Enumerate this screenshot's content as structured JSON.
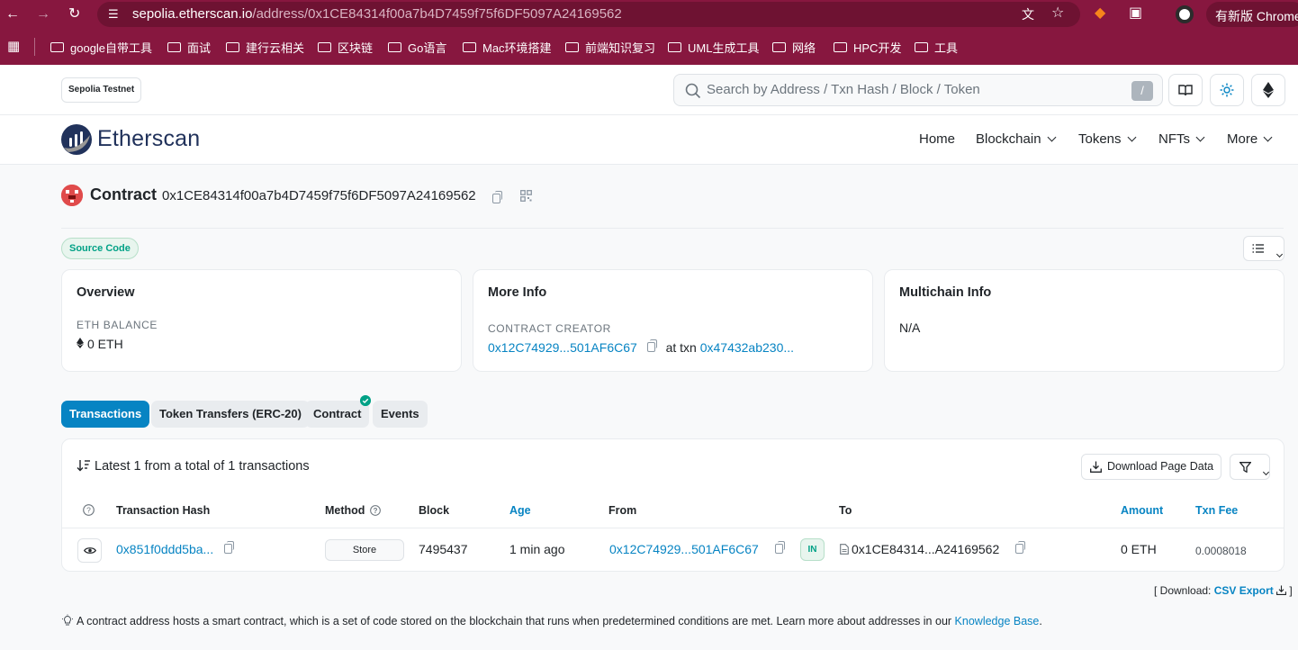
{
  "browser": {
    "url_host": "sepolia.etherscan.io",
    "url_path": "/address/0x1CE84314f00a7b4D7459f75f6DF5097A24169562",
    "update_label": "有新版 Chrome",
    "bookmarks": [
      "google自带工具",
      "面试",
      "建行云相关",
      "区块链",
      "Go语言",
      "Mac环境搭建",
      "前端知识复习",
      "UML生成工具",
      "网络",
      "HPC开发",
      "工具"
    ]
  },
  "header": {
    "network_label": "Sepolia Testnet",
    "search_placeholder": "Search by Address / Txn Hash / Block / Token",
    "search_shortcut": "/",
    "logo_text": "Etherscan",
    "nav": [
      "Home",
      "Blockchain",
      "Tokens",
      "NFTs",
      "More"
    ]
  },
  "contract": {
    "title": "Contract",
    "address": "0x1CE84314f00a7b4D7459f75f6DF5097A24169562",
    "source_badge": "Source Code"
  },
  "overview": {
    "title": "Overview",
    "balance_label": "ETH BALANCE",
    "balance_value": "0 ETH"
  },
  "more_info": {
    "title": "More Info",
    "creator_label": "CONTRACT CREATOR",
    "creator_address": "0x12C74929...501AF6C67",
    "at_txn_label": "at txn",
    "txn_hash": "0x47432ab230..."
  },
  "multichain": {
    "title": "Multichain Info",
    "value": "N/A"
  },
  "tabs": [
    "Transactions",
    "Token Transfers (ERC-20)",
    "Contract",
    "Events"
  ],
  "transactions": {
    "summary": "Latest 1 from a total of 1 transactions",
    "download_label": "Download Page Data",
    "columns": [
      "Transaction Hash",
      "Method",
      "Block",
      "Age",
      "From",
      "To",
      "Amount",
      "Txn Fee"
    ],
    "rows": [
      {
        "hash": "0x851f0ddd5ba...",
        "method": "Store",
        "block": "7495437",
        "age": "1 min ago",
        "from": "0x12C74929...501AF6C67",
        "direction": "IN",
        "to": "0x1CE84314...A24169562",
        "amount": "0 ETH",
        "fee": "0.0008018"
      }
    ]
  },
  "footer": {
    "download_prefix": "[ Download:",
    "csv_label": "CSV Export",
    "download_suffix": "]",
    "note": "A contract address hosts a smart contract, which is a set of code stored on the blockchain that runs when predetermined conditions are met. Learn more about addresses in our",
    "knowledge_link": "Knowledge Base",
    "note_end": "."
  },
  "colors": {
    "chrome_bar": "#87173f",
    "accent_blue": "#0784c3",
    "success_green": "#00a186",
    "logo_navy": "#21325b"
  }
}
